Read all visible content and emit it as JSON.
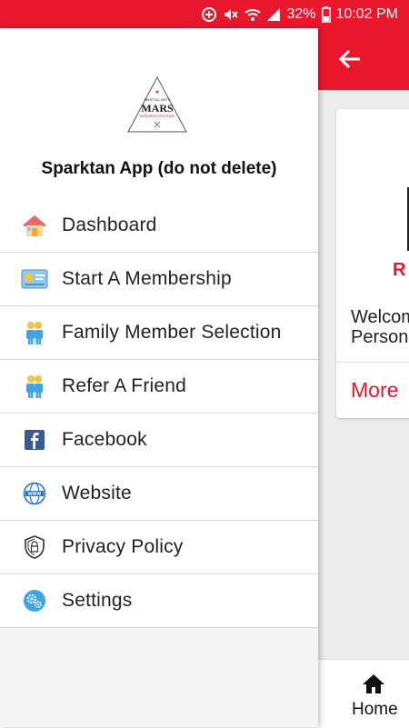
{
  "status_bar": {
    "battery": "32%",
    "time": "10:02 PM"
  },
  "drawer": {
    "logo": {
      "top_text": "MARTIAL ARTS",
      "main_text": "MARS",
      "bottom_text": "RESEARCH SYSTEMS"
    },
    "app_name": "Sparktan App (do not delete)",
    "items": [
      {
        "label": "Dashboard",
        "icon": "house-icon"
      },
      {
        "label": "Start A Membership",
        "icon": "membership-card-icon"
      },
      {
        "label": "Family Member Selection",
        "icon": "family-icon"
      },
      {
        "label": "Refer A Friend",
        "icon": "refer-friend-icon"
      },
      {
        "label": "Facebook",
        "icon": "facebook-icon"
      },
      {
        "label": "Website",
        "icon": "globe-icon"
      },
      {
        "label": "Privacy Policy",
        "icon": "shield-icon"
      },
      {
        "label": "Settings",
        "icon": "gear-icon"
      }
    ]
  },
  "background": {
    "card_text": "Welcome\nPersonal",
    "card_logo_letter": "R",
    "more_label": "More",
    "bottom_nav_home": "Home"
  },
  "colors": {
    "accent": "#e8172c"
  }
}
